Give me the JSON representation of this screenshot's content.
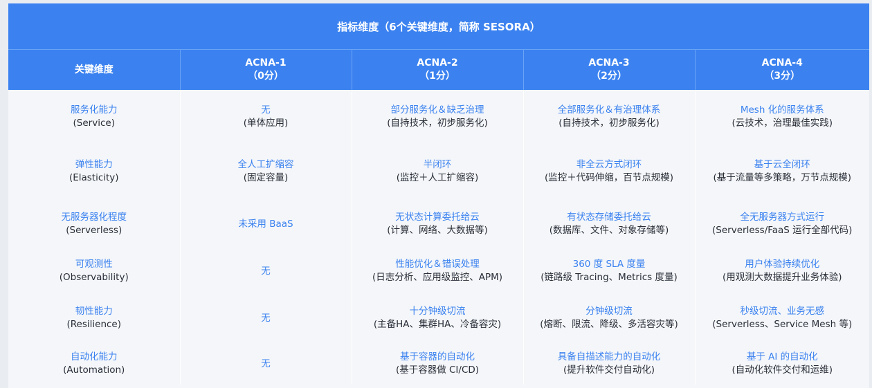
{
  "table": {
    "banner": "指标维度（6个关键维度，简称 SESORA）",
    "headers": [
      {
        "line1": "关键维度",
        "line2": ""
      },
      {
        "line1": "ACNA-1",
        "line2": "（0分）"
      },
      {
        "line1": "ACNA-2",
        "line2": "（1分）"
      },
      {
        "line1": "ACNA-3",
        "line2": "（2分）"
      },
      {
        "line1": "ACNA-4",
        "line2": "（3分）"
      }
    ],
    "rows": [
      {
        "dimension": {
          "name": "服务化能力",
          "en": "(Service)"
        },
        "cells": [
          {
            "main": "无",
            "sub": "(单体应用)"
          },
          {
            "main": "部分服务化＆缺乏治理",
            "sub": "(自持技术，初步服务化)"
          },
          {
            "main": "全部服务化＆有治理体系",
            "sub": "(自持技术，初步服务化)"
          },
          {
            "main": "Mesh 化的服务体系",
            "sub": "(云技术，治理最佳实践)"
          }
        ]
      },
      {
        "dimension": {
          "name": "弹性能力",
          "en": "(Elasticity)"
        },
        "cells": [
          {
            "main": "全人工扩缩容",
            "sub": "(固定容量)"
          },
          {
            "main": "半闭环",
            "sub": "(监控＋人工扩缩容)"
          },
          {
            "main": "非全云方式闭环",
            "sub": "(监控＋代码伸缩，百节点规模)"
          },
          {
            "main": "基于云全闭环",
            "sub": "(基于流量等多策略，万节点规模)"
          }
        ]
      },
      {
        "dimension": {
          "name": "无服务器化程度",
          "en": "(Serverless)"
        },
        "cells": [
          {
            "main": "未采用 BaaS",
            "sub": ""
          },
          {
            "main": "无状态计算委托给云",
            "sub": "(计算、网络、大数据等)"
          },
          {
            "main": "有状态存储委托给云",
            "sub": "(数据库、文件、对象存储等)"
          },
          {
            "main": "全无服务器方式运行",
            "sub": "(Serverless/FaaS 运行全部代码)"
          }
        ]
      },
      {
        "dimension": {
          "name": "可观测性",
          "en": "(Observability)"
        },
        "cells": [
          {
            "main": "无",
            "sub": ""
          },
          {
            "main": "性能优化＆错误处理",
            "sub": "(日志分析、应用级监控、APM)"
          },
          {
            "main": "360 度 SLA 度量",
            "sub": "(链路级 Tracing、Metrics 度量)"
          },
          {
            "main": "用户体验持续优化",
            "sub": "(用观测大数据提升业务体验)"
          }
        ]
      },
      {
        "dimension": {
          "name": "韧性能力",
          "en": "(Resilience)"
        },
        "cells": [
          {
            "main": "无",
            "sub": ""
          },
          {
            "main": "十分钟级切流",
            "sub": "(主备HA、集群HA、冷备容灾)"
          },
          {
            "main": "分钟级切流",
            "sub": "(熔断、限流、降级、多活容灾等)"
          },
          {
            "main": "秒级切流、业务无感",
            "sub": "(Serverless、Service Mesh 等)"
          }
        ]
      },
      {
        "dimension": {
          "name": "自动化能力",
          "en": "(Automation)"
        },
        "cells": [
          {
            "main": "无",
            "sub": ""
          },
          {
            "main": "基于容器的自动化",
            "sub": "(基于容器做 CI/CD)"
          },
          {
            "main": "具备自描述能力的自动化",
            "sub": "(提升软件交付自动化)"
          },
          {
            "main": "基于 AI 的自动化",
            "sub": "(自动化软件交付和运维)"
          }
        ]
      }
    ]
  }
}
